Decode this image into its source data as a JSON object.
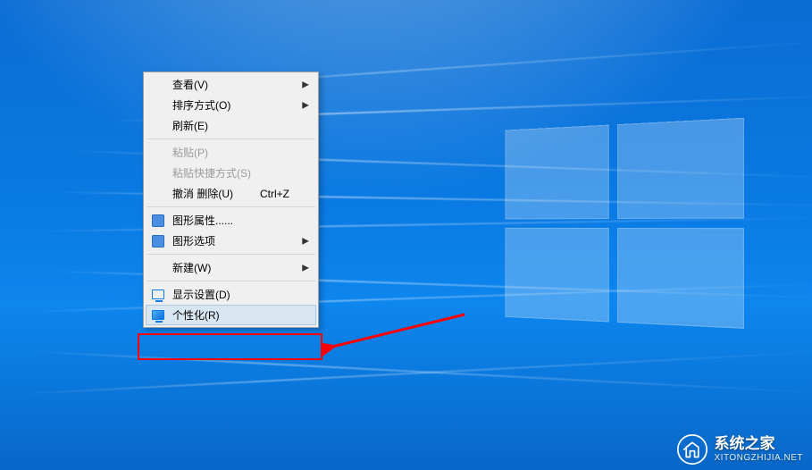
{
  "context_menu": {
    "items": [
      {
        "id": "view",
        "label": "查看(V)",
        "has_submenu": true,
        "disabled": false,
        "icon": null
      },
      {
        "id": "sort",
        "label": "排序方式(O)",
        "has_submenu": true,
        "disabled": false,
        "icon": null
      },
      {
        "id": "refresh",
        "label": "刷新(E)",
        "has_submenu": false,
        "disabled": false,
        "icon": null
      },
      {
        "separator": true
      },
      {
        "id": "paste",
        "label": "粘贴(P)",
        "has_submenu": false,
        "disabled": true,
        "icon": null
      },
      {
        "id": "paste-shortcut",
        "label": "粘贴快捷方式(S)",
        "has_submenu": false,
        "disabled": true,
        "icon": null
      },
      {
        "id": "undo-delete",
        "label": "撤消 删除(U)",
        "shortcut": "Ctrl+Z",
        "has_submenu": false,
        "disabled": false,
        "icon": null
      },
      {
        "separator": true
      },
      {
        "id": "gfx-props",
        "label": "图形属性......",
        "has_submenu": false,
        "disabled": false,
        "icon": "blue-square"
      },
      {
        "id": "gfx-options",
        "label": "图形选项",
        "has_submenu": true,
        "disabled": false,
        "icon": "blue-square"
      },
      {
        "separator": true
      },
      {
        "id": "new",
        "label": "新建(W)",
        "has_submenu": true,
        "disabled": false,
        "icon": null
      },
      {
        "separator": true
      },
      {
        "id": "display",
        "label": "显示设置(D)",
        "has_submenu": false,
        "disabled": false,
        "icon": "monitor"
      },
      {
        "id": "personalize",
        "label": "个性化(R)",
        "has_submenu": false,
        "disabled": false,
        "icon": "monitor-g",
        "hover": true
      }
    ]
  },
  "annotation": {
    "highlight_target": "personalize"
  },
  "watermark": {
    "title": "系统之家",
    "url": "XITONGZHIJIA.NET"
  }
}
